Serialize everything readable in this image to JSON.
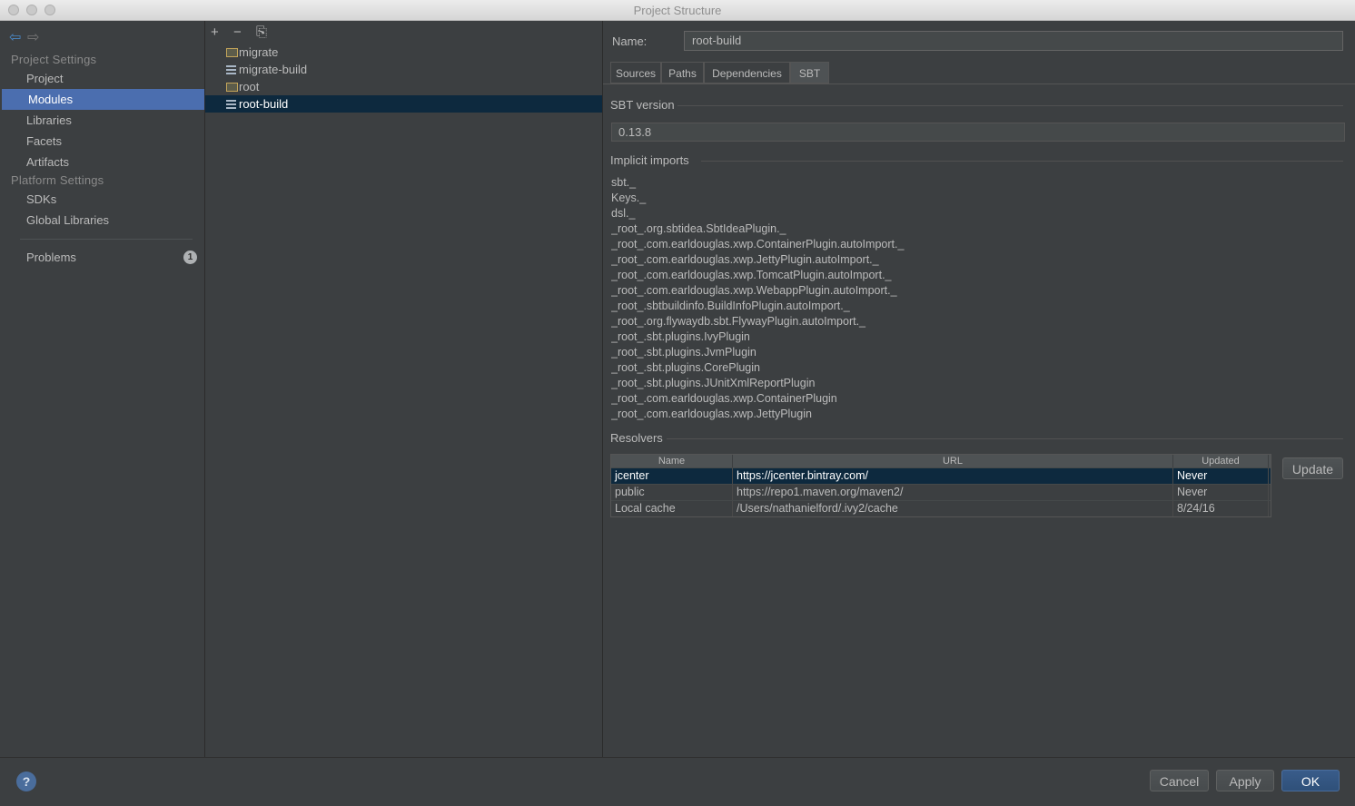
{
  "window": {
    "title": "Project Structure"
  },
  "sidebar": {
    "project_settings_label": "Project Settings",
    "platform_settings_label": "Platform Settings",
    "items": [
      {
        "label": "Project"
      },
      {
        "label": "Modules"
      },
      {
        "label": "Libraries"
      },
      {
        "label": "Facets"
      },
      {
        "label": "Artifacts"
      },
      {
        "label": "SDKs"
      },
      {
        "label": "Global Libraries"
      },
      {
        "label": "Problems",
        "badge": "1"
      }
    ]
  },
  "modules": {
    "toolbar": {
      "add": "+",
      "remove": "−",
      "copy": "⎘"
    },
    "items": [
      {
        "label": "migrate",
        "icon": "folder-icon"
      },
      {
        "label": "migrate-build",
        "icon": "module-icon"
      },
      {
        "label": "root",
        "icon": "folder-icon"
      },
      {
        "label": "root-build",
        "icon": "module-icon"
      }
    ]
  },
  "details": {
    "name_label": "Name:",
    "name_value": "root-build",
    "tabs": [
      "Sources",
      "Paths",
      "Dependencies",
      "SBT"
    ],
    "sbt_version_label": "SBT version",
    "sbt_version_value": "0.13.8",
    "implicit_imports_label": "Implicit imports",
    "implicit_imports": [
      "sbt._",
      "Keys._",
      "dsl._",
      "_root_.org.sbtidea.SbtIdeaPlugin._",
      "_root_.com.earldouglas.xwp.ContainerPlugin.autoImport._",
      "_root_.com.earldouglas.xwp.JettyPlugin.autoImport._",
      "_root_.com.earldouglas.xwp.TomcatPlugin.autoImport._",
      "_root_.com.earldouglas.xwp.WebappPlugin.autoImport._",
      "_root_.sbtbuildinfo.BuildInfoPlugin.autoImport._",
      "_root_.org.flywaydb.sbt.FlywayPlugin.autoImport._",
      "_root_.sbt.plugins.IvyPlugin",
      "_root_.sbt.plugins.JvmPlugin",
      "_root_.sbt.plugins.CorePlugin",
      "_root_.sbt.plugins.JUnitXmlReportPlugin",
      "_root_.com.earldouglas.xwp.ContainerPlugin",
      "_root_.com.earldouglas.xwp.JettyPlugin"
    ],
    "resolvers_label": "Resolvers",
    "resolvers_columns": [
      "Name",
      "URL",
      "Updated"
    ],
    "resolvers": [
      {
        "name": "jcenter",
        "url": "https://jcenter.bintray.com/",
        "updated": "Never"
      },
      {
        "name": "public",
        "url": "https://repo1.maven.org/maven2/",
        "updated": "Never"
      },
      {
        "name": "Local cache",
        "url": "/Users/nathanielford/.ivy2/cache",
        "updated": "8/24/16"
      }
    ],
    "update_button": "Update"
  },
  "footer": {
    "help": "?",
    "cancel": "Cancel",
    "apply": "Apply",
    "ok": "OK"
  },
  "colors": {
    "selection_sidebar": "#4b6eaf",
    "selection_list": "#0d293e",
    "background": "#3c3f41"
  }
}
